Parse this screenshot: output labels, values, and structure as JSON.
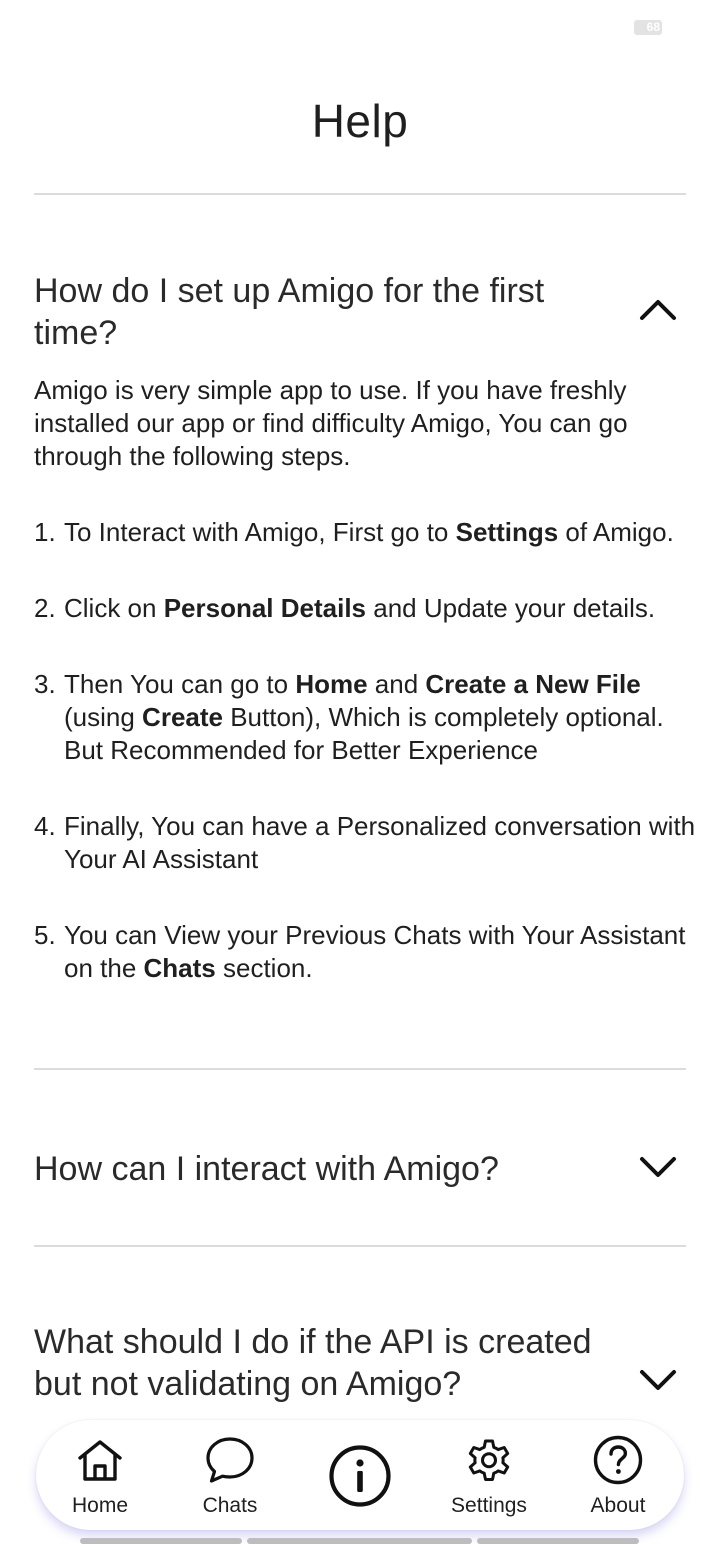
{
  "status_bar": {
    "battery_text": "68"
  },
  "page": {
    "title": "Help"
  },
  "faq": [
    {
      "question": "How do I set up Amigo for the first time?",
      "expanded": true,
      "answer_intro": "Amigo is very simple app to use. If you have freshly installed our app or find difficulty Amigo, You can go through the following steps.",
      "steps": [
        {
          "num": "1.",
          "text_html": "To Interact with Amigo, First go to <b>Settings</b> of Amigo."
        },
        {
          "num": "2.",
          "text_html": "Click on <b>Personal Details</b> and Update your details."
        },
        {
          "num": "3.",
          "text_html": "Then You can go to <b>Home</b> and <b>Create a New File</b> (using <b>Create</b> Button), Which is completely optional. But Recommended for Better Experience"
        },
        {
          "num": "4.",
          "text_html": "Finally, You can have a Personalized conversation with Your AI Assistant"
        },
        {
          "num": "5.",
          "text_html": "You can View your Previous Chats with Your Assistant on the <b>Chats</b> section."
        }
      ]
    },
    {
      "question": "How can I interact with Amigo?",
      "expanded": false
    },
    {
      "question": "What should I do if the API is created but not validating on Amigo?",
      "expanded": false
    }
  ],
  "nav": {
    "home": "Home",
    "chats": "Chats",
    "center_icon": "info-icon",
    "settings": "Settings",
    "about": "About"
  },
  "icons": {
    "expanded": "chevron-up-icon",
    "collapsed": "chevron-down-icon",
    "home": "home-icon",
    "chats": "chat-bubble-icon",
    "settings": "gear-icon",
    "about": "question-circle-icon"
  }
}
